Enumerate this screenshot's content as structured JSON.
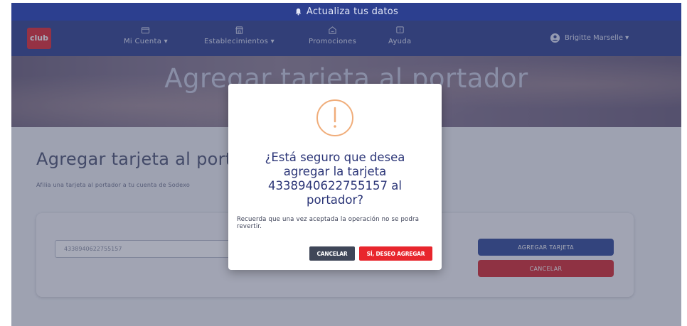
{
  "banner": {
    "text": "Actualiza tus datos",
    "icon": "bell-icon"
  },
  "logo": {
    "small_text": "",
    "text": "club"
  },
  "nav": {
    "items": [
      {
        "label": "Mi Cuenta ▾",
        "icon": "wallet-icon"
      },
      {
        "label": "Establecimientos ▾",
        "icon": "store-icon"
      },
      {
        "label": "Promociones",
        "icon": "promo-icon"
      },
      {
        "label": "Ayuda",
        "icon": "help-icon"
      }
    ],
    "user": {
      "name": "Brigitte Marselle ▾",
      "icon": "user-icon"
    }
  },
  "hero": {
    "title": "Agregar tarjeta al portador"
  },
  "page": {
    "title": "Agregar tarjeta al portador",
    "description": "Afilia una tarjeta al portador a tu cuenta de Sodexo"
  },
  "form": {
    "card_number_value": "4338940622755157",
    "add_button": "AGREGAR TARJETA",
    "cancel_button": "CANCELAR"
  },
  "modal": {
    "icon": "warning-icon",
    "question": "¿Está seguro que desea agregar la tarjeta 4338940622755157 al portador?",
    "note": "Recuerda que una vez aceptada la operación no se podra revertir.",
    "cancel_button": "CANCELAR",
    "confirm_button": "SÍ, DESEO AGREGAR"
  },
  "colors": {
    "primary": "#2c4595",
    "danger": "#e8262d",
    "warning": "#f0ad7a",
    "nav": "#2a3d8c"
  }
}
